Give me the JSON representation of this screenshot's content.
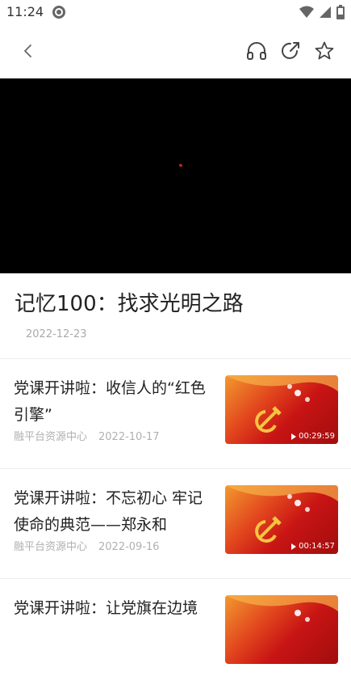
{
  "status_bar": {
    "time": "11:24",
    "icons": [
      "app-icon",
      "wifi-icon",
      "signal-icon",
      "battery-icon"
    ]
  },
  "toolbar": {
    "icons": [
      "back-icon",
      "headphones-icon",
      "share-icon",
      "star-icon"
    ]
  },
  "video": {
    "background": "#000000"
  },
  "article": {
    "title": "记忆100：找求光明之路",
    "date": "2022-12-23"
  },
  "news": [
    {
      "title": "党课开讲啦：收信人的“红色引擎”",
      "source": "融平台资源中心",
      "date": "2022-10-17",
      "duration": "00:29:59"
    },
    {
      "title": "党课开讲啦：不忘初心 牢记使命的典范——郑永和",
      "source": "融平台资源中心",
      "date": "2022-09-16",
      "duration": "00:14:57"
    },
    {
      "title": "党课开讲啦：让党旗在边境",
      "source": "",
      "date": "",
      "duration": ""
    }
  ],
  "colors": {
    "accent_red": "#c81414",
    "meta_gray": "#b0b0b0"
  }
}
